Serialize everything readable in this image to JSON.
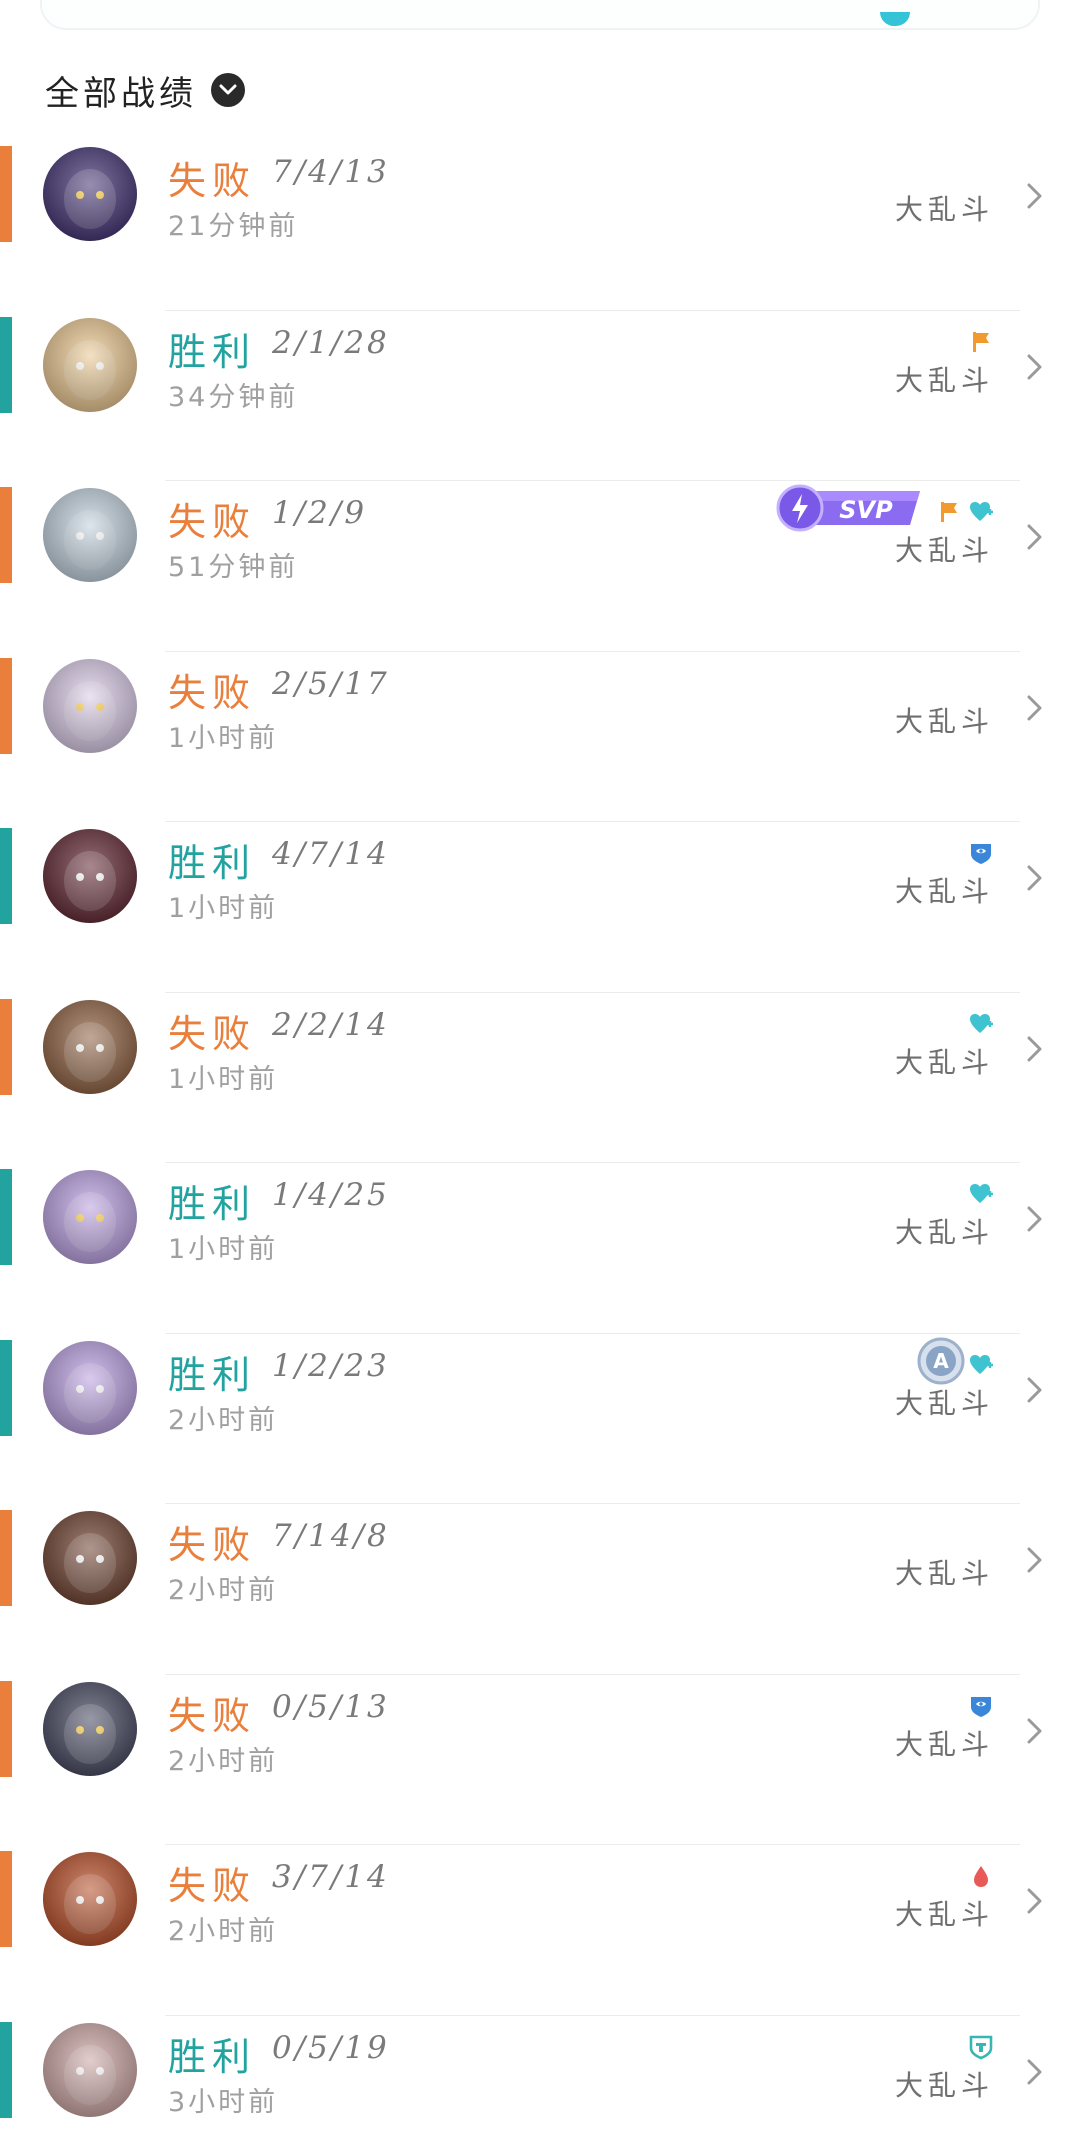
{
  "header": {
    "filter_label": "全部战绩"
  },
  "colors": {
    "win": "#22a39f",
    "loss": "#e97f3b"
  },
  "matches": [
    {
      "result": "失败",
      "outcome": "loss",
      "kda": "7/4/13",
      "time": "21分钟前",
      "mode": "大乱斗",
      "badges": [],
      "svp": false,
      "ace": false,
      "avatar_color": "#3b2a6e"
    },
    {
      "result": "胜利",
      "outcome": "win",
      "kda": "2/1/28",
      "time": "34分钟前",
      "mode": "大乱斗",
      "badges": [
        "orange-flag-icon"
      ],
      "svp": false,
      "ace": false,
      "avatar_color": "#e9c58c"
    },
    {
      "result": "失败",
      "outcome": "loss",
      "kda": "1/2/9",
      "time": "51分钟前",
      "mode": "大乱斗",
      "badges": [
        "orange-flag-icon",
        "heart-plus-icon"
      ],
      "svp": true,
      "svp_label": "SVP",
      "ace": false,
      "avatar_color": "#bfcfdc"
    },
    {
      "result": "失败",
      "outcome": "loss",
      "kda": "2/5/17",
      "time": "1小时前",
      "mode": "大乱斗",
      "badges": [],
      "svp": false,
      "ace": false,
      "avatar_color": "#d9c9e6"
    },
    {
      "result": "胜利",
      "outcome": "win",
      "kda": "4/7/14",
      "time": "1小时前",
      "mode": "大乱斗",
      "badges": [
        "shield-badge-icon"
      ],
      "svp": false,
      "ace": false,
      "avatar_color": "#5b1f2a"
    },
    {
      "result": "失败",
      "outcome": "loss",
      "kda": "2/2/14",
      "time": "1小时前",
      "mode": "大乱斗",
      "badges": [
        "heart-plus-icon"
      ],
      "svp": false,
      "ace": false,
      "avatar_color": "#8a5a3a"
    },
    {
      "result": "胜利",
      "outcome": "win",
      "kda": "1/4/25",
      "time": "1小时前",
      "mode": "大乱斗",
      "badges": [
        "heart-plus-icon"
      ],
      "svp": false,
      "ace": false,
      "avatar_color": "#b79be0"
    },
    {
      "result": "胜利",
      "outcome": "win",
      "kda": "1/2/23",
      "time": "2小时前",
      "mode": "大乱斗",
      "badges": [
        "heart-plus-icon"
      ],
      "svp": false,
      "ace": true,
      "ace_label": "A",
      "avatar_color": "#b79be0"
    },
    {
      "result": "失败",
      "outcome": "loss",
      "kda": "7/14/8",
      "time": "2小时前",
      "mode": "大乱斗",
      "badges": [],
      "svp": false,
      "ace": false,
      "avatar_color": "#6a3a28"
    },
    {
      "result": "失败",
      "outcome": "loss",
      "kda": "0/5/13",
      "time": "2小时前",
      "mode": "大乱斗",
      "badges": [
        "shield-badge-icon"
      ],
      "svp": false,
      "ace": false,
      "avatar_color": "#3d3f58"
    },
    {
      "result": "失败",
      "outcome": "loss",
      "kda": "3/7/14",
      "time": "2小时前",
      "mode": "大乱斗",
      "badges": [
        "blood-drop-icon"
      ],
      "svp": false,
      "ace": false,
      "avatar_color": "#b5461e"
    },
    {
      "result": "胜利",
      "outcome": "win",
      "kda": "0/5/19",
      "time": "3小时前",
      "mode": "大乱斗",
      "badges": [
        "tower-shield-icon"
      ],
      "svp": false,
      "ace": false,
      "avatar_color": "#c9a2a0"
    }
  ]
}
